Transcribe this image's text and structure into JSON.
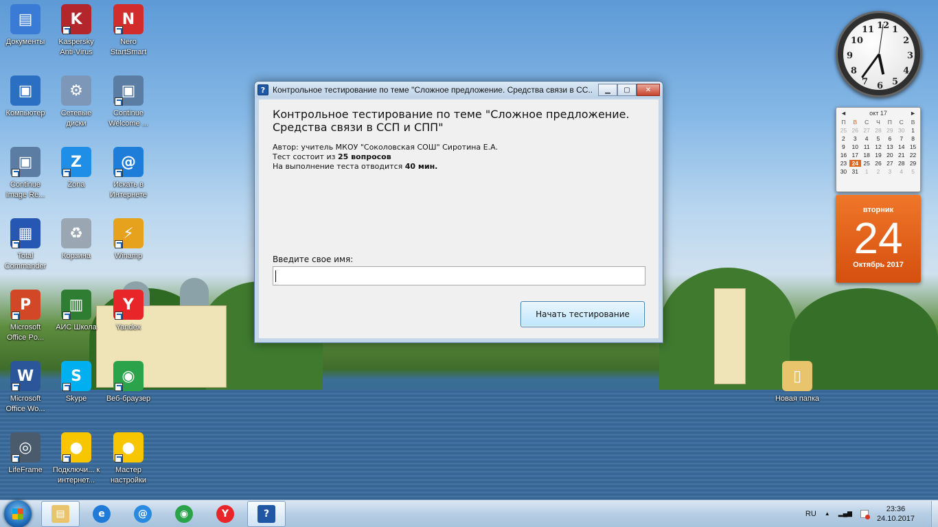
{
  "desktop": {
    "icons": [
      {
        "label": "Документы",
        "color": "#3a7bd5",
        "glyph": "▤"
      },
      {
        "label": "Kaspersky Anti-Virus",
        "color": "#b3262c",
        "glyph": "K"
      },
      {
        "label": "Nero StartSmart",
        "color": "#d32c2c",
        "glyph": "N"
      },
      {
        "label": "Компьютер",
        "color": "#2a6fc2",
        "glyph": "▣"
      },
      {
        "label": "Сетевые диски",
        "color": "#7d97b8",
        "glyph": "⚙"
      },
      {
        "label": "Continue Welcome ...",
        "color": "#5b7da4",
        "glyph": "▣"
      },
      {
        "label": "Continue Image Re...",
        "color": "#5b7da4",
        "glyph": "▣"
      },
      {
        "label": "Zona",
        "color": "#1f8ee6",
        "glyph": "Z"
      },
      {
        "label": "Искать в Интернете",
        "color": "#1d7dd8",
        "glyph": "@"
      },
      {
        "label": "Total Commander",
        "color": "#2557b3",
        "glyph": "▦"
      },
      {
        "label": "Корзина",
        "color": "#9aa7b2",
        "glyph": "♻"
      },
      {
        "label": "Winamp",
        "color": "#e6a21d",
        "glyph": "⚡"
      },
      {
        "label": "Microsoft Office Po...",
        "color": "#d24726",
        "glyph": "P"
      },
      {
        "label": "АИС Школа",
        "color": "#2e7d32",
        "glyph": "▥"
      },
      {
        "label": "Yandex",
        "color": "#e8262a",
        "glyph": "Y"
      },
      {
        "label": "Microsoft Office Wo...",
        "color": "#2b579a",
        "glyph": "W"
      },
      {
        "label": "Skype",
        "color": "#00aff0",
        "glyph": "S"
      },
      {
        "label": "Веб-браузер",
        "color": "#2aa34a",
        "glyph": "◉"
      },
      {
        "label": "LifeFrame",
        "color": "#4a5b6e",
        "glyph": "◎"
      },
      {
        "label": "Подключи... к интернет...",
        "color": "#f7c600",
        "glyph": "●"
      },
      {
        "label": "Мастер настройки",
        "color": "#f7c600",
        "glyph": "●"
      },
      {
        "label": "Новая папка",
        "color": "#e8c46c",
        "glyph": "▯"
      }
    ]
  },
  "gadgets": {
    "clock": {
      "numbers": [
        "12",
        "1",
        "2",
        "3",
        "4",
        "5",
        "6",
        "7",
        "8",
        "9",
        "10",
        "11"
      ]
    },
    "calendar": {
      "month_label": "окт 17",
      "prev": "◄",
      "next": "►",
      "dow": [
        "П",
        "В",
        "С",
        "Ч",
        "П",
        "С",
        "В"
      ],
      "days": [
        {
          "d": "25",
          "dim": true
        },
        {
          "d": "26",
          "dim": true
        },
        {
          "d": "27",
          "dim": true
        },
        {
          "d": "28",
          "dim": true
        },
        {
          "d": "29",
          "dim": true
        },
        {
          "d": "30",
          "dim": true
        },
        {
          "d": "1"
        },
        {
          "d": "2"
        },
        {
          "d": "3"
        },
        {
          "d": "4"
        },
        {
          "d": "5"
        },
        {
          "d": "6"
        },
        {
          "d": "7"
        },
        {
          "d": "8"
        },
        {
          "d": "9"
        },
        {
          "d": "10"
        },
        {
          "d": "11"
        },
        {
          "d": "12"
        },
        {
          "d": "13"
        },
        {
          "d": "14"
        },
        {
          "d": "15"
        },
        {
          "d": "16"
        },
        {
          "d": "17"
        },
        {
          "d": "18"
        },
        {
          "d": "19"
        },
        {
          "d": "20"
        },
        {
          "d": "21"
        },
        {
          "d": "22"
        },
        {
          "d": "23"
        },
        {
          "d": "24",
          "today": true
        },
        {
          "d": "25"
        },
        {
          "d": "26"
        },
        {
          "d": "27"
        },
        {
          "d": "28"
        },
        {
          "d": "29"
        },
        {
          "d": "30"
        },
        {
          "d": "31"
        },
        {
          "d": "1",
          "dim": true
        },
        {
          "d": "2",
          "dim": true
        },
        {
          "d": "3",
          "dim": true
        },
        {
          "d": "4",
          "dim": true
        },
        {
          "d": "5",
          "dim": true
        }
      ],
      "weekday": "вторник",
      "day_number": "24",
      "month_year": "Октябрь 2017"
    }
  },
  "window": {
    "title": "Контрольное тестирование по теме \"Сложное предложение. Средства связи в СС...",
    "icon_glyph": "?",
    "minimize": "▁",
    "maximize": "▢",
    "close": "✕",
    "heading": "Контрольное тестирование по теме \"Сложное предложение. Средства связи в ССП и СПП\"",
    "author": "Автор: учитель МКОУ \"Соколовская СОШ\" Сиротина Е.А.",
    "questions_prefix": "Тест состоит из ",
    "questions_value": "25 вопросов",
    "time_prefix": "На выполнение теста отводится ",
    "time_value": "40 мин.",
    "name_label": "Введите свое имя:",
    "name_value": "",
    "start_button": "Начать тестирование"
  },
  "taskbar": {
    "items": [
      {
        "name": "explorer",
        "color": "#e8c46c",
        "glyph": "▤",
        "active": true
      },
      {
        "name": "ie",
        "color": "#1f7ad8",
        "glyph": "e"
      },
      {
        "name": "mail",
        "color": "#2a8ae0",
        "glyph": "@"
      },
      {
        "name": "chrome",
        "color": "#2aa34a",
        "glyph": "◉"
      },
      {
        "name": "yandex",
        "color": "#e8262a",
        "glyph": "Y"
      },
      {
        "name": "test-app",
        "color": "#1f57a5",
        "glyph": "?",
        "active": true
      }
    ],
    "lang": "RU",
    "tray_up": "▲",
    "signal": "▂▄▆",
    "time": "23:36",
    "date": "24.10.2017"
  }
}
